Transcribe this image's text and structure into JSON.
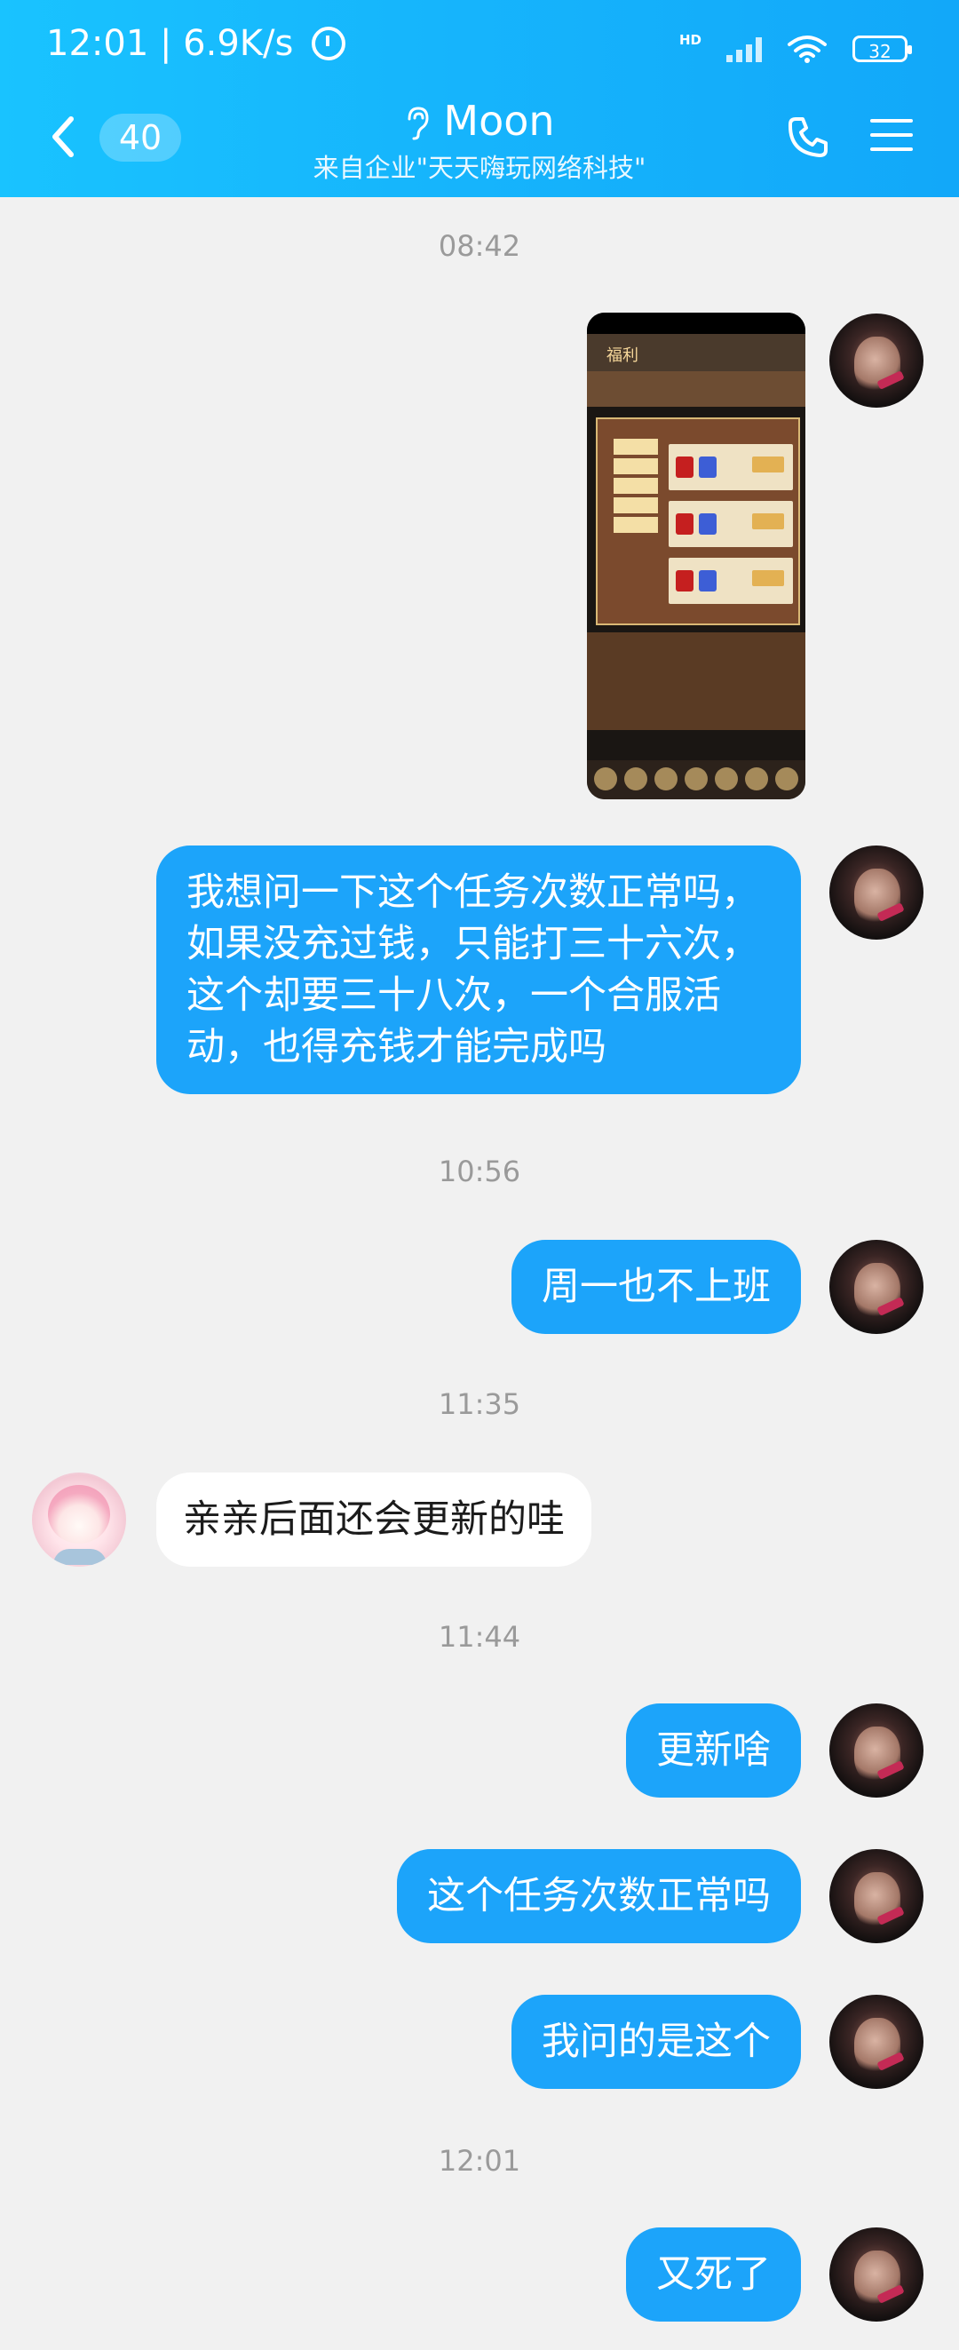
{
  "status_bar": {
    "time_speed": "12:01 | 6.9K/s",
    "network": "HD",
    "battery": "32"
  },
  "header": {
    "unread_count": "40",
    "contact_name": "Moon",
    "subtitle": "来自企业\"天天嗨玩网络科技\""
  },
  "messages": {
    "t1": "08:42",
    "m2": "我想问一下这个任务次数正常吗，如果没充过钱，只能打三十六次，这个却要三十八次，一个合服活动，也得充钱才能完成吗",
    "t2": "10:56",
    "m3": "周一也不上班",
    "t3": "11:35",
    "m4": "亲亲后面还会更新的哇",
    "t4": "11:44",
    "m5": "更新啥",
    "m6": "这个任务次数正常吗",
    "m7": "我问的是这个",
    "t5": "12:01",
    "m8": "又死了"
  },
  "screenshot": {
    "label": "福利"
  }
}
